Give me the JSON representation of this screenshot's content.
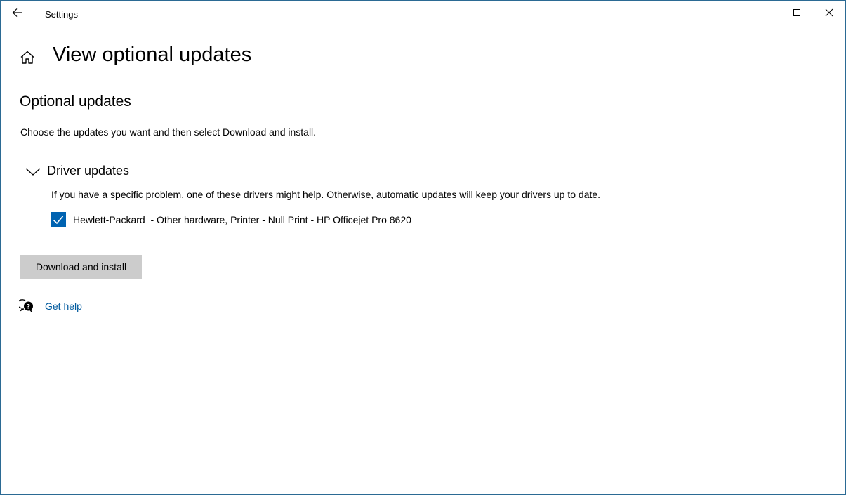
{
  "window": {
    "title": "Settings",
    "controls": {
      "minimize": "minimize-icon",
      "maximize": "maximize-icon",
      "close": "close-icon"
    }
  },
  "header": {
    "home_icon": "home-icon",
    "title": "View optional updates"
  },
  "main": {
    "section_title": "Optional updates",
    "instructions": "Choose the updates you want and then select Download and install.",
    "driver_updates": {
      "title": "Driver updates",
      "expanded": true,
      "description": "If you have a specific problem, one of these drivers might help. Otherwise, automatic updates will keep your drivers up to date.",
      "items": [
        {
          "label": "Hewlett-Packard  - Other hardware, Printer - Null Print - HP Officejet Pro 8620",
          "checked": true
        }
      ]
    },
    "download_button": "Download and install",
    "get_help": "Get help"
  },
  "colors": {
    "accent": "#0063b1",
    "link": "#005a9e",
    "button_bg": "#cccccc",
    "window_border": "#2b6a94"
  }
}
